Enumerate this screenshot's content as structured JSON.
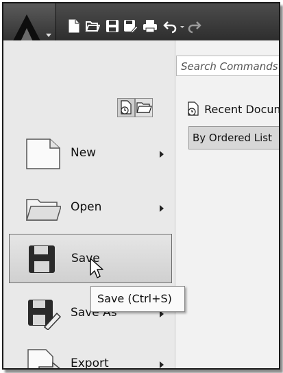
{
  "search": {
    "placeholder": "Search Commands"
  },
  "recent": {
    "label": "Recent Documents"
  },
  "order_by": {
    "value": "By Ordered List"
  },
  "menu": [
    {
      "label": "New",
      "has_submenu": true
    },
    {
      "label": "Open",
      "has_submenu": true
    },
    {
      "label": "Save",
      "has_submenu": false,
      "selected": true
    },
    {
      "label": "Save As",
      "has_submenu": true
    },
    {
      "label": "Export",
      "has_submenu": true
    }
  ],
  "tooltip": {
    "text": "Save (Ctrl+S)"
  },
  "icons": {
    "app": "autocad-logo-icon",
    "quick_access": [
      "new-icon",
      "open-icon",
      "save-icon",
      "save-as-icon",
      "print-icon",
      "undo-icon",
      "redo-icon"
    ],
    "view_toggles": [
      "recent-documents-icon",
      "open-documents-icon"
    ]
  }
}
